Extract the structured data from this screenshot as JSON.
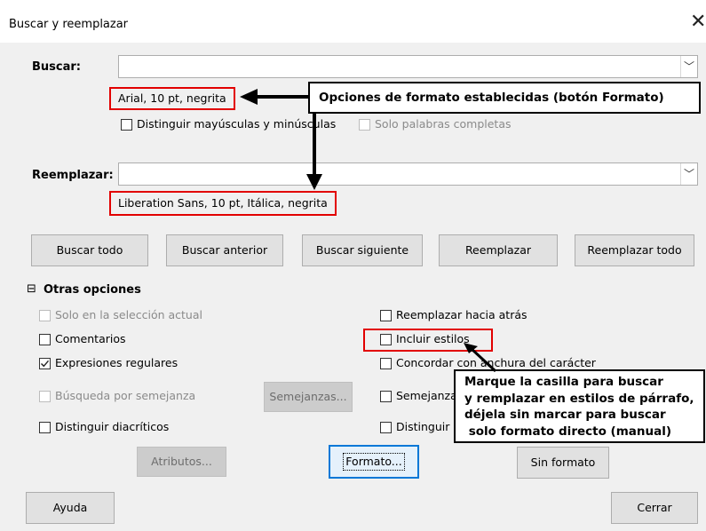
{
  "dialog": {
    "title": "Buscar y reemplazar",
    "close_glyph": "✕"
  },
  "search": {
    "label": "Buscar:",
    "value": "",
    "format": "Arial, 10 pt, negrita",
    "match_case": "Distinguir mayúsculas y minúsculas",
    "whole_words": "Solo palabras completas"
  },
  "replace": {
    "label": "Reemplazar:",
    "value": "",
    "format": "Liberation Sans, 10 pt, Itálica, negrita"
  },
  "buttons": {
    "find_all": "Buscar todo",
    "find_prev": "Buscar anterior",
    "find_next": "Buscar siguiente",
    "replace": "Reemplazar",
    "replace_all": "Reemplazar todo",
    "similarities": "Semejanzas...",
    "attributes": "Atributos...",
    "format": "Formato...",
    "no_format": "Sin formato",
    "help": "Ayuda",
    "close": "Cerrar"
  },
  "other_options": {
    "header": "Otras opciones",
    "toggle_glyph": "⊟",
    "left": [
      {
        "label": "Solo en la selección actual",
        "checked": false,
        "disabled": true
      },
      {
        "label": "Comentarios",
        "checked": false,
        "disabled": false
      },
      {
        "label": "Expresiones regulares",
        "checked": true,
        "disabled": false
      },
      {
        "label": "Búsqueda por semejanza",
        "checked": false,
        "disabled": true
      },
      {
        "label": "Distinguir diacríticos",
        "checked": false,
        "disabled": false
      }
    ],
    "right": [
      {
        "label": "Reemplazar hacia atrás",
        "checked": false
      },
      {
        "label": "Incluir estilos",
        "checked": false
      },
      {
        "label": "Concordar con anchura del carácter",
        "checked": false
      },
      {
        "label": "Semejanza",
        "checked": false
      },
      {
        "label": "Distinguir",
        "checked": false
      }
    ]
  },
  "annotations": {
    "callout_format": "Opciones de formato establecidas (botón Formato)",
    "callout_styles": [
      "Marque la casilla para buscar",
      "y remplazar en estilos de párrafo,",
      "déjela sin marcar para buscar",
      " solo formato directo (manual)"
    ],
    "highlight_color": "#e20000"
  }
}
